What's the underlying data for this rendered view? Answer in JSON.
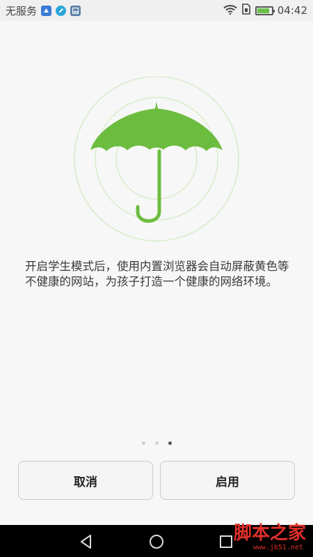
{
  "status_bar": {
    "carrier": "无服务",
    "time": "04:42",
    "battery_level": 0.85,
    "notification_icons": [
      "app-notification-icon",
      "edit-icon",
      "image-icon"
    ]
  },
  "illustration": {
    "icon": "umbrella-icon",
    "color": "#6cbd3f"
  },
  "description": "开启学生模式后，使用内置浏览器会自动屏蔽黄色等不健康的网站，为孩子打造一个健康的网络环境。",
  "pager": {
    "count": 3,
    "active_index": 2
  },
  "buttons": {
    "cancel": "取消",
    "enable": "启用"
  },
  "watermark": {
    "text": "脚本之家",
    "url": "www.jb51.net"
  }
}
